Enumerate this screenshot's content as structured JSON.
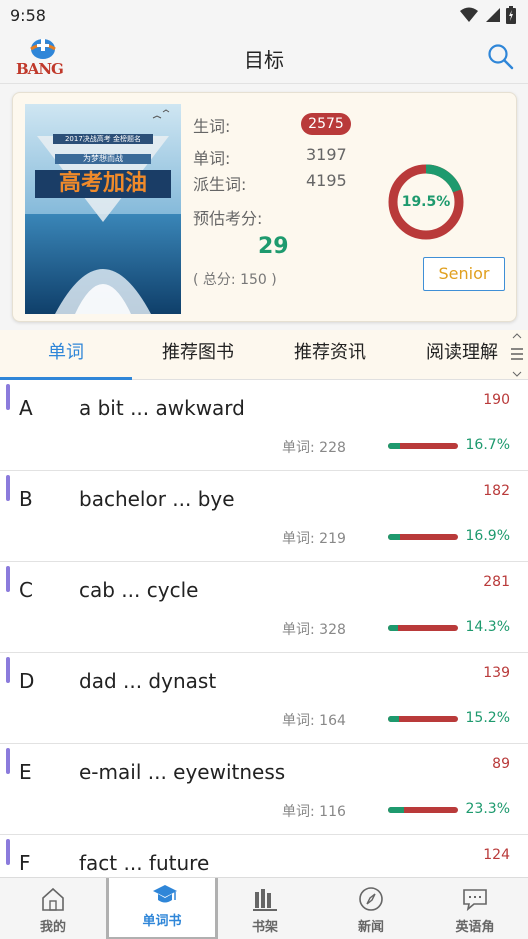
{
  "status_bar": {
    "time": "9:58"
  },
  "header": {
    "logo_text": "BANG",
    "title": "目标"
  },
  "summary": {
    "new_words_label": "生词:",
    "new_words_value": "2575",
    "words_label": "单词:",
    "words_value": "3197",
    "derived_label": "派生词:",
    "derived_value": "4195",
    "estimate_label": "预估考分:",
    "estimate_value": "29",
    "total_text": "( 总分: 150 )",
    "progress_label": "19.5%",
    "progress_fraction": 0.195,
    "level_button": "Senior",
    "cover": {
      "banner_top": "2017决战高考 金榜题名",
      "banner_mid": "为梦想而战",
      "headline": "高考加油"
    }
  },
  "tabs": [
    {
      "label": "单词",
      "active": true
    },
    {
      "label": "推荐图书",
      "active": false
    },
    {
      "label": "推荐资讯",
      "active": false
    },
    {
      "label": "阅读理解",
      "active": false
    }
  ],
  "letters": [
    {
      "letter": "A",
      "range": "a bit ... awkward",
      "count": "190",
      "words": "单词: 228",
      "pct": "16.7%",
      "fraction": 0.167
    },
    {
      "letter": "B",
      "range": "bachelor ... bye",
      "count": "182",
      "words": "单词: 219",
      "pct": "16.9%",
      "fraction": 0.169
    },
    {
      "letter": "C",
      "range": "cab ... cycle",
      "count": "281",
      "words": "单词: 328",
      "pct": "14.3%",
      "fraction": 0.143
    },
    {
      "letter": "D",
      "range": "dad ... dynast",
      "count": "139",
      "words": "单词: 164",
      "pct": "15.2%",
      "fraction": 0.152
    },
    {
      "letter": "E",
      "range": "e-mail ... eyewitness",
      "count": "89",
      "words": "单词: 116",
      "pct": "23.3%",
      "fraction": 0.233
    },
    {
      "letter": "F",
      "range": "fact ... future",
      "count": "124",
      "words": "",
      "pct": "",
      "fraction": 0
    }
  ],
  "bottom_nav": [
    {
      "label": "我的",
      "icon": "home-icon",
      "active": false
    },
    {
      "label": "单词书",
      "icon": "graduation-cap-icon",
      "active": true
    },
    {
      "label": "书架",
      "icon": "bookshelf-icon",
      "active": false
    },
    {
      "label": "新闻",
      "icon": "compass-icon",
      "active": false
    },
    {
      "label": "英语角",
      "icon": "chat-icon",
      "active": false
    }
  ],
  "colors": {
    "accent_blue": "#2f86d8",
    "green": "#1e9a6e",
    "red": "#b93a3a",
    "card_bg": "#fdf8ee"
  }
}
